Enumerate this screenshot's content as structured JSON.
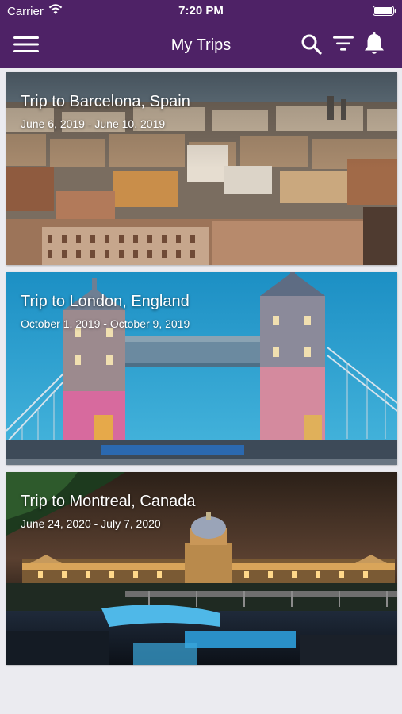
{
  "status_bar": {
    "carrier": "Carrier",
    "time": "7:20 PM"
  },
  "nav": {
    "title": "My Trips",
    "icons": [
      "menu-icon",
      "search-icon",
      "filter-icon",
      "bell-icon"
    ]
  },
  "colors": {
    "header": "#4e2266",
    "background": "#ebebf0",
    "text_on_dark": "#ffffff"
  },
  "trips": [
    {
      "title": "Trip to Barcelona, Spain",
      "dates": "June 6, 2019 - June 10, 2019"
    },
    {
      "title": "Trip to London, England",
      "dates": "October 1, 2019 - October 9, 2019"
    },
    {
      "title": "Trip to Montreal, Canada",
      "dates": "June 24, 2020 - July 7, 2020"
    }
  ]
}
